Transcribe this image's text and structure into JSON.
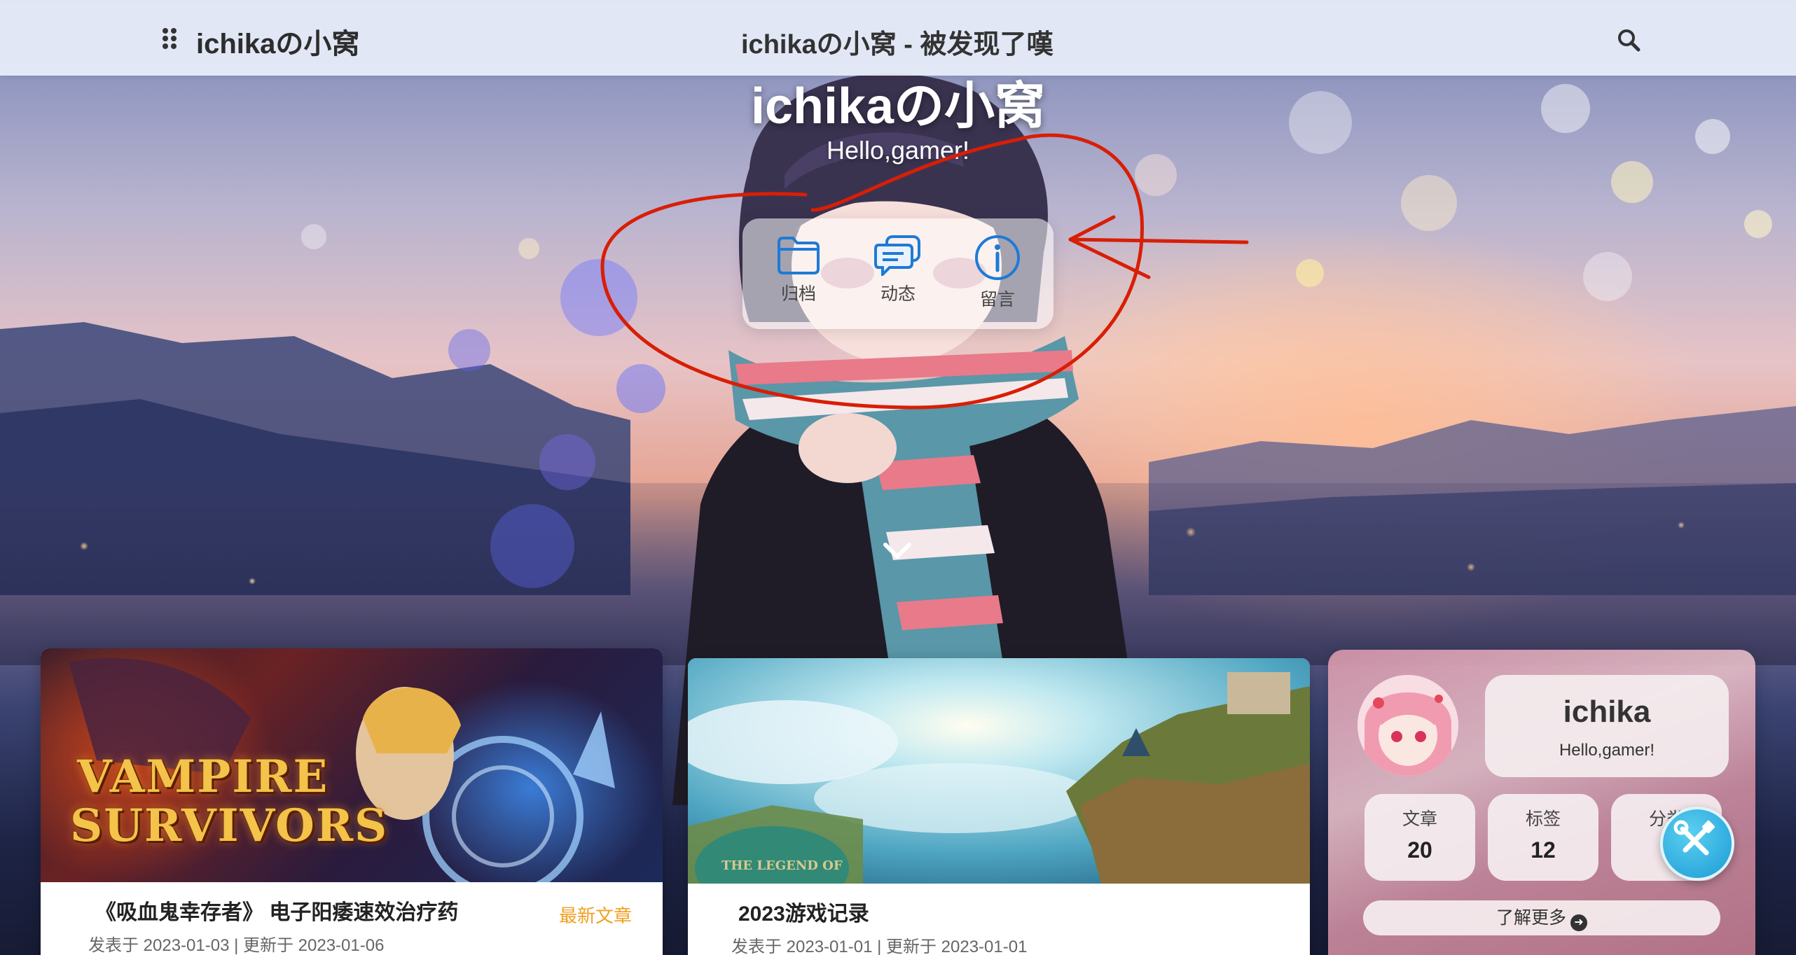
{
  "navbar": {
    "brand": "ichikaの小窝",
    "center_title": "ichikaの小窝 - 被发现了嘆",
    "menu_icon": "grid-dots-icon",
    "search_icon": "search-icon"
  },
  "hero": {
    "title": "ichikaの小窝",
    "subtitle": "Hello,gamer!",
    "quick_links": [
      {
        "label": "归档",
        "icon": "folder-icon"
      },
      {
        "label": "动态",
        "icon": "chat-bubbles-icon"
      },
      {
        "label": "留言",
        "icon": "info-icon"
      }
    ],
    "scroll_icon": "chevron-down-icon"
  },
  "posts": [
    {
      "title": "《吸血鬼幸存者》 电子阳痿速效治疗药",
      "badge": "最新文章",
      "meta": "发表于 2023-01-03 | 更新于 2023-01-06",
      "cover_text_line1": "VAMPIRE",
      "cover_text_line2": "SURVIVORS"
    },
    {
      "title": "2023游戏记录",
      "meta": "发表于 2023-01-01 | 更新于 2023-01-01",
      "cover_text": "THE LEGEND OF"
    }
  ],
  "profile": {
    "name": "ichika",
    "tagline": "Hello,gamer!",
    "stats": [
      {
        "label": "文章",
        "value": "20"
      },
      {
        "label": "标签",
        "value": "12"
      },
      {
        "label": "分类",
        "value": ""
      }
    ],
    "more_button": "了解更多"
  },
  "colors": {
    "navbar_bg": "#e8eefa",
    "accent_blue": "#1e7ad6",
    "badge_orange": "#f0a020",
    "annotation_red": "#d81e06",
    "tool_button": "#1c9ad6"
  }
}
